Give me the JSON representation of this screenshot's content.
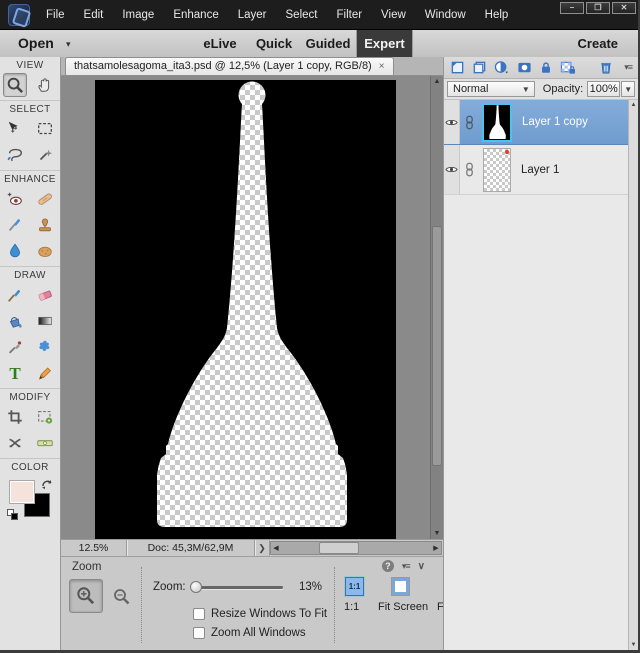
{
  "window": {
    "controls": {
      "minimize": "–",
      "maximize": "❐",
      "close": "✕"
    }
  },
  "menubar": {
    "items": [
      "File",
      "Edit",
      "Image",
      "Enhance",
      "Layer",
      "Select",
      "Filter",
      "View",
      "Window",
      "Help"
    ]
  },
  "modebar": {
    "open": "Open",
    "tabs": [
      "eLive",
      "Quick",
      "Guided",
      "Expert"
    ],
    "active_tab": "Expert",
    "create": "Create"
  },
  "toolbar": {
    "selected_tool": "zoom",
    "type_tool_glyph": "T",
    "foreground_color": "#f5e2db",
    "background_color": "#000000",
    "sections": [
      {
        "title": "VIEW",
        "tools": [
          "zoom",
          "hand"
        ]
      },
      {
        "title": "SELECT",
        "tools": [
          "move",
          "rectangular-marquee",
          "lasso",
          "quick-selection"
        ]
      },
      {
        "title": "ENHANCE",
        "tools": [
          "red-eye-removal",
          "spot-healing-brush",
          "smart-brush",
          "clone-stamp",
          "blur",
          "sponge"
        ]
      },
      {
        "title": "DRAW",
        "tools": [
          "brush",
          "eraser",
          "paint-bucket",
          "gradient",
          "eyedropper",
          "custom-shape",
          "type",
          "pencil"
        ]
      },
      {
        "title": "MODIFY",
        "tools": [
          "crop",
          "recompose",
          "content-aware-move",
          "straighten"
        ]
      },
      {
        "title": "COLOR",
        "tools": [
          "foreground-background-swatches"
        ]
      }
    ]
  },
  "document": {
    "tab_title": "thatsamolesagoma_ita3.psd @ 12,5% (Layer 1 copy, RGB/8)",
    "tab_close": "×",
    "zoom_percent": "12.5%",
    "doc_size": "Doc: 45,3M/62,9M",
    "canvas_bg": "#000000",
    "subject": "mole-antonelliana-silhouette-transparent"
  },
  "tool_options": {
    "title": "Zoom",
    "zoom_label": "Zoom:",
    "zoom_value": "13%",
    "checkboxes": [
      {
        "label": "Resize Windows To Fit",
        "checked": false
      },
      {
        "label": "Zoom All Windows",
        "checked": false
      }
    ],
    "one_to_one_button": "1:1",
    "one_to_one_label": "1:1",
    "fit_screen_label": "Fit Screen",
    "clipped_next_label": "F"
  },
  "layers_panel": {
    "header_icons": [
      "new-layer",
      "new-group",
      "new-adjustment-layer",
      "add-layer-mask",
      "lock-all",
      "lock-transparent-pixels",
      "delete-layer",
      "panel-menu"
    ],
    "blend_mode": "Normal",
    "opacity_label": "Opacity:",
    "opacity_value": "100%",
    "layers": [
      {
        "name": "Layer 1 copy",
        "selected": true,
        "visible": true,
        "linked_icon": true
      },
      {
        "name": "Layer 1",
        "selected": false,
        "visible": true,
        "linked_icon": true
      }
    ]
  },
  "colors": {
    "selection_blue": "#79a3d6",
    "accent_blue": "#3a76c8",
    "expert_tab_bg": "#3a3a3a",
    "checker_gray": "#c9c9c9"
  }
}
